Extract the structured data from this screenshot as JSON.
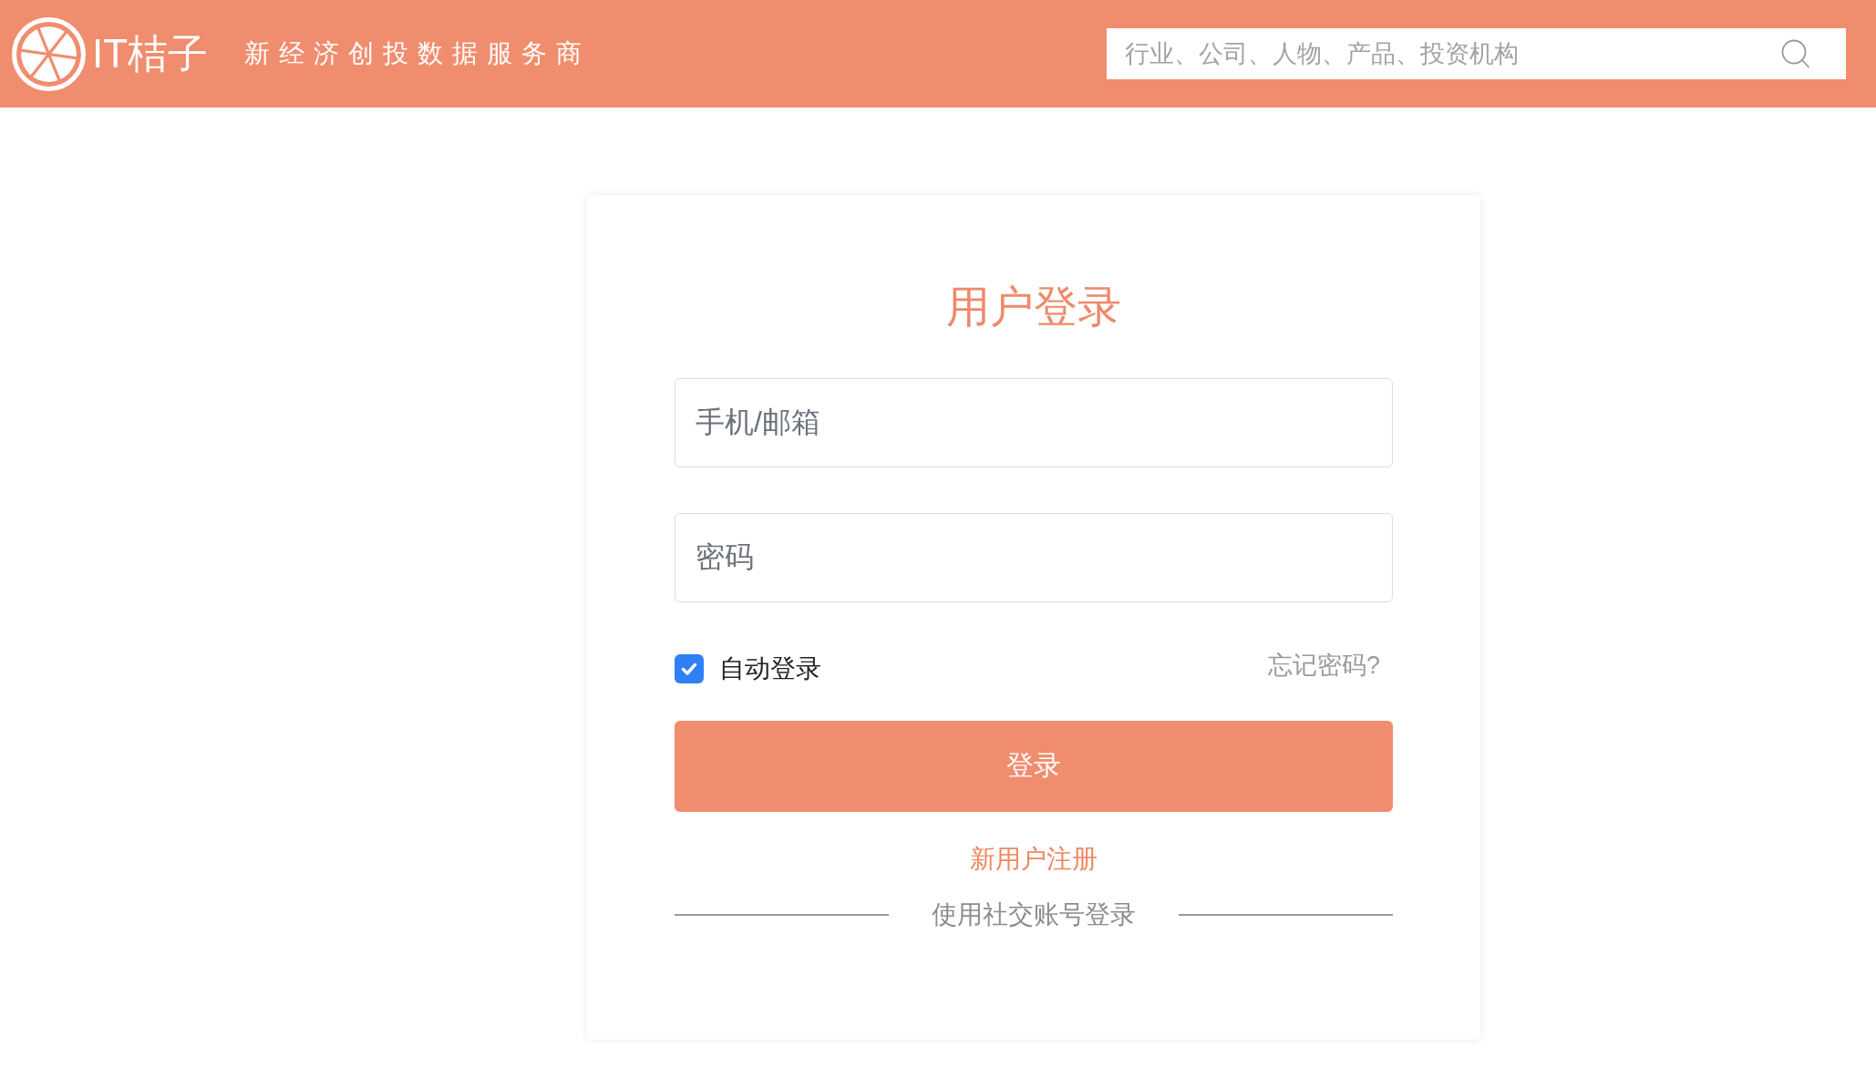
{
  "header": {
    "logo_text": "IT桔子",
    "tagline": "新经济创投数据服务商",
    "search": {
      "placeholder": "行业、公司、人物、产品、投资机构"
    }
  },
  "login_card": {
    "title": "用户登录",
    "fields": [
      {
        "placeholder": "手机/邮箱"
      },
      {
        "placeholder": "密码"
      }
    ],
    "auto_login": {
      "label": "自动登录",
      "checked": true
    },
    "forgot_link": "忘记密码?",
    "submit_button": "登录",
    "register_link": "新用户注册",
    "social_divider": "使用社交账号登录"
  }
}
